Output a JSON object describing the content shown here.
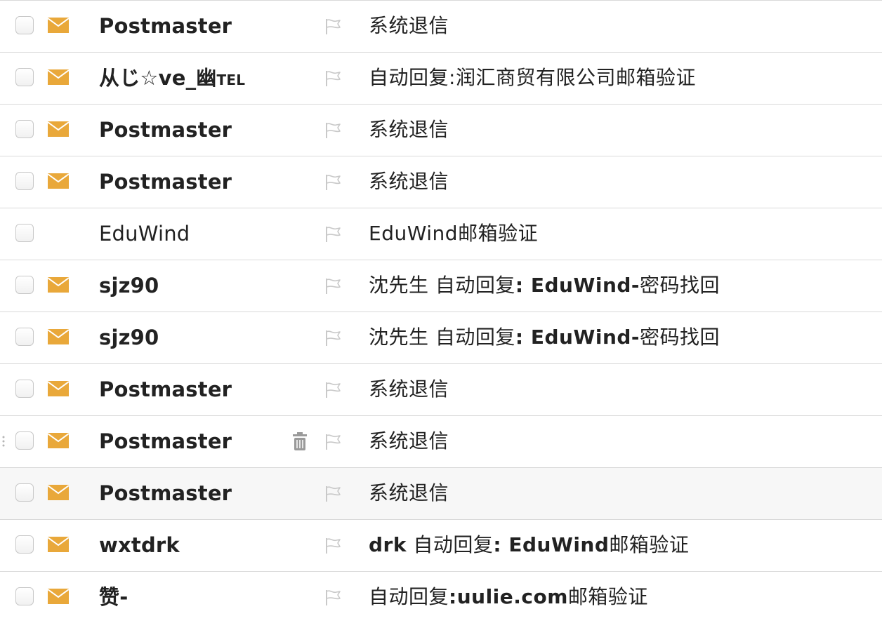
{
  "colors": {
    "unread_icon": "#e9a83a",
    "flag_icon": "#c9c9c9",
    "trash_icon": "#9a9a9a",
    "divider": "#d9d9d9",
    "hover_row_bg": "#f7f7f7",
    "text": "#222222"
  },
  "rows": [
    {
      "sender": "Postmaster",
      "sender_suffix": "",
      "subject_parts": [
        {
          "text": "系统退信",
          "bold": false
        }
      ],
      "unread": true,
      "bold": true,
      "hover": false,
      "trash": false
    },
    {
      "sender": "从じ☆ve_幽",
      "sender_suffix": "TEL",
      "subject_parts": [
        {
          "text": "自动回复:",
          "bold": false
        },
        {
          "text": "润汇商贸有限公司邮箱验证",
          "bold": false
        }
      ],
      "unread": true,
      "bold": true,
      "hover": false,
      "trash": false
    },
    {
      "sender": "Postmaster",
      "sender_suffix": "",
      "subject_parts": [
        {
          "text": "系统退信",
          "bold": false
        }
      ],
      "unread": true,
      "bold": true,
      "hover": false,
      "trash": false
    },
    {
      "sender": "Postmaster",
      "sender_suffix": "",
      "subject_parts": [
        {
          "text": "系统退信",
          "bold": false
        }
      ],
      "unread": true,
      "bold": true,
      "hover": false,
      "trash": false
    },
    {
      "sender": "EduWind",
      "sender_suffix": "",
      "subject_parts": [
        {
          "text": "EduWind邮箱验证",
          "bold": false
        }
      ],
      "unread": false,
      "bold": false,
      "hover": false,
      "trash": false
    },
    {
      "sender": "sjz90",
      "sender_suffix": "",
      "subject_parts": [
        {
          "text": "沈先生 自动回复",
          "bold": false
        },
        {
          "text": ": EduWind-",
          "bold": true
        },
        {
          "text": "密码找回",
          "bold": false
        }
      ],
      "unread": true,
      "bold": true,
      "hover": false,
      "trash": false
    },
    {
      "sender": "sjz90",
      "sender_suffix": "",
      "subject_parts": [
        {
          "text": "沈先生 自动回复",
          "bold": false
        },
        {
          "text": ": EduWind-",
          "bold": true
        },
        {
          "text": "密码找回",
          "bold": false
        }
      ],
      "unread": true,
      "bold": true,
      "hover": false,
      "trash": false
    },
    {
      "sender": "Postmaster",
      "sender_suffix": "",
      "subject_parts": [
        {
          "text": "系统退信",
          "bold": false
        }
      ],
      "unread": true,
      "bold": true,
      "hover": false,
      "trash": false
    },
    {
      "sender": "Postmaster",
      "sender_suffix": "",
      "subject_parts": [
        {
          "text": "系统退信",
          "bold": false
        }
      ],
      "unread": true,
      "bold": true,
      "hover": false,
      "trash": true
    },
    {
      "sender": "Postmaster",
      "sender_suffix": "",
      "subject_parts": [
        {
          "text": "系统退信",
          "bold": false
        }
      ],
      "unread": true,
      "bold": true,
      "hover": true,
      "trash": false
    },
    {
      "sender": "wxtdrk",
      "sender_suffix": "",
      "subject_parts": [
        {
          "text": "drk",
          "bold": true
        },
        {
          "text": " 自动回复",
          "bold": false
        },
        {
          "text": ": EduWind",
          "bold": true
        },
        {
          "text": "邮箱验证",
          "bold": false
        }
      ],
      "unread": true,
      "bold": true,
      "hover": false,
      "trash": false
    },
    {
      "sender": "赞-",
      "sender_suffix": "",
      "subject_parts": [
        {
          "text": "自动回复",
          "bold": false
        },
        {
          "text": ":uulie.com",
          "bold": true
        },
        {
          "text": "邮箱验证",
          "bold": false
        }
      ],
      "unread": true,
      "bold": true,
      "hover": false,
      "trash": false
    }
  ]
}
